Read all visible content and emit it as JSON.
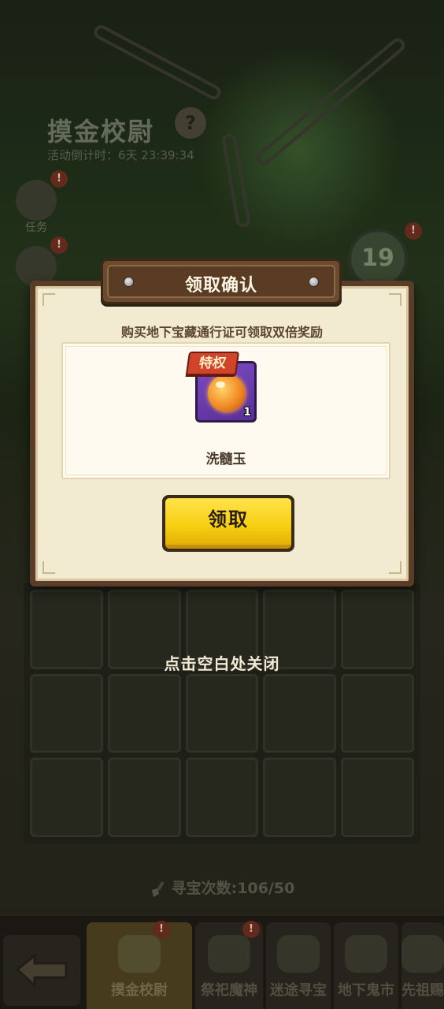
{
  "background": {
    "event_title": "摸金校尉",
    "countdown": "活动倒计时：6天 23:39:34",
    "help_glyph": "?",
    "side_buttons": [
      {
        "label": "任务",
        "badge": "!"
      },
      {
        "label": "",
        "badge": "!"
      }
    ],
    "counter_value": "19",
    "counter_badge": "!",
    "hunt_count": "寻宝次数:106/50",
    "nav_tabs": [
      {
        "label": "摸金校尉",
        "active": true,
        "badge": "!"
      },
      {
        "label": "祭祀魔神",
        "active": false,
        "badge": "!"
      },
      {
        "label": "迷途寻宝",
        "active": false,
        "badge": ""
      },
      {
        "label": "地下鬼市",
        "active": false,
        "badge": ""
      },
      {
        "label": "先祖赐",
        "active": false,
        "badge": ""
      }
    ]
  },
  "dialog": {
    "title": "领取确认",
    "subtitle": "购买地下宝藏通行证可领取双倍奖励",
    "reward": {
      "tag": "特权",
      "count": "1",
      "name": "洗髓玉",
      "icon": "orange-orb-icon"
    },
    "claim_button": "领取"
  },
  "close_hint": "点击空白处关闭",
  "colors": {
    "claim_button": "#f6cf12",
    "privilege_tag": "#d2442a",
    "item_slot": "#7c4bc2",
    "dialog_panel": "#f3ead2",
    "dialog_frame": "#5a3d28"
  }
}
